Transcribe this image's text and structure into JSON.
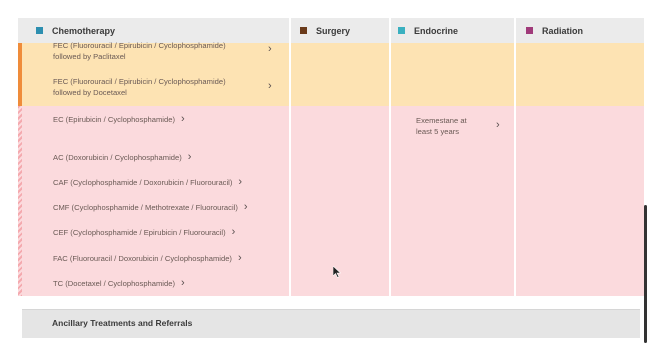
{
  "columns": [
    {
      "label": "Chemotherapy",
      "color": "#2d8fb0"
    },
    {
      "label": "Surgery",
      "color": "#6a3a1a"
    },
    {
      "label": "Endocrine",
      "color": "#3ab0c0"
    },
    {
      "label": "Radiation",
      "color": "#a03a7a"
    }
  ],
  "chemotherapy": {
    "orange_items": [
      {
        "line1": "FEC (Fluorouracil / Epirubicin / Cyclophosphamide)",
        "line2": "followed by Paclitaxel"
      },
      {
        "line1": "FEC (Fluorouracil / Epirubicin / Cyclophosphamide)",
        "line2": "followed by Docetaxel"
      }
    ],
    "pink_items": [
      "EC (Epirubicin / Cyclophosphamide)",
      "AC (Doxorubicin / Cyclophosphamide)",
      "CAF (Cyclophosphamide / Doxorubicin / Fluorouracil)",
      "CMF (Cyclophosphamide / Methotrexate / Fluorouracil)",
      "CEF (Cyclophosphamide / Epirubicin / Fluorouracil)",
      "FAC (Fluorouracil / Doxorubicin / Cyclophosphamide)",
      "TC (Docetaxel / Cyclophosphamide)"
    ]
  },
  "endocrine": {
    "pink_items": [
      {
        "line1": "Exemestane at",
        "line2": "least 5 years"
      }
    ]
  },
  "ancillary": {
    "title": "Ancillary Treatments and Referrals"
  }
}
